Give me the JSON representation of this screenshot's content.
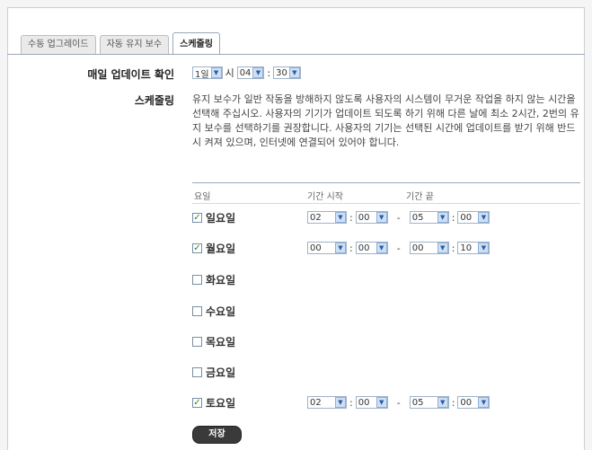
{
  "tabs": [
    {
      "label": "수동 업그레이드"
    },
    {
      "label": "자동 유지 보수"
    },
    {
      "label": "스케줄링"
    }
  ],
  "daily_check": {
    "label": "매일 업데이트 확인",
    "day_value": "1일",
    "hour_prefix": "시",
    "hour_value": "04",
    "sep": ":",
    "minute_value": "30"
  },
  "scheduling": {
    "label": "스케줄링",
    "description": "유지 보수가 일반 작동을 방해하지 않도록 사용자의 시스템이 무거운 작업을 하지 않는 시간을 선택해 주십시오. 사용자의 기기가 업데이트 되도록 하기 위해 다른 날에 최소 2시간, 2번의 유지 보수를 선택하기를 권장합니다. 사용자의 기기는 선택된 시간에 업데이트를 받기 위해 반드시 켜져 있으며, 인터넷에 연결되어 있어야 합니다."
  },
  "table": {
    "col_day": "요일",
    "col_start": "기간 시작",
    "col_end": "기간 끝",
    "dash": "-",
    "sep": ":"
  },
  "days": [
    {
      "name": "일요일",
      "checked": true,
      "start_h": "02",
      "start_m": "00",
      "end_h": "05",
      "end_m": "00"
    },
    {
      "name": "월요일",
      "checked": true,
      "start_h": "00",
      "start_m": "00",
      "end_h": "00",
      "end_m": "10"
    },
    {
      "name": "화요일",
      "checked": false
    },
    {
      "name": "수요일",
      "checked": false
    },
    {
      "name": "목요일",
      "checked": false
    },
    {
      "name": "금요일",
      "checked": false
    },
    {
      "name": "토요일",
      "checked": true,
      "start_h": "02",
      "start_m": "00",
      "end_h": "05",
      "end_m": "00"
    }
  ],
  "save_label": "저장",
  "colors": {
    "accent": "#9aa8b8",
    "check": "#2a8a2a"
  }
}
